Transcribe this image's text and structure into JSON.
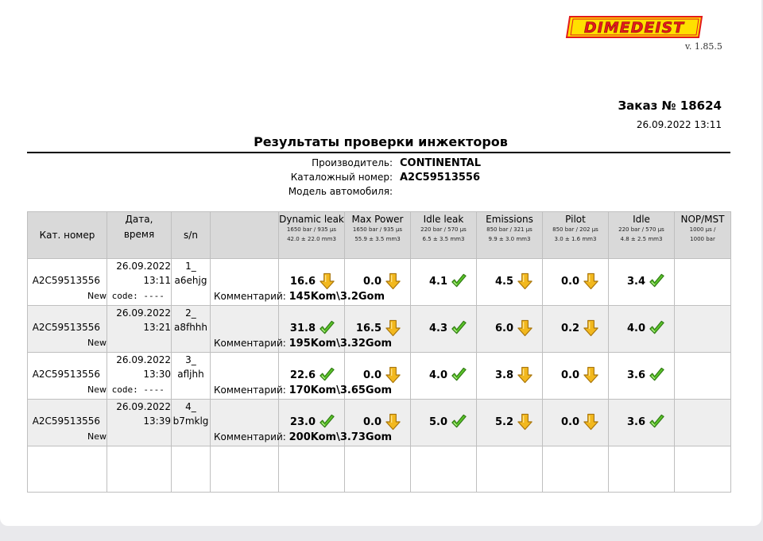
{
  "logo": {
    "text": "DIMEDEIST"
  },
  "version": "v. 1.85.5",
  "order": {
    "title": "Заказ № 18624",
    "date": "26.09.2022  13:11"
  },
  "doc_title": "Результаты проверки инжекторов",
  "info": [
    {
      "label": "Производитель:",
      "value": "CONTINENTAL"
    },
    {
      "label": "Каталожный номер:",
      "value": "A2C59513556"
    },
    {
      "label": "Модель автомобиля:",
      "value": ""
    }
  ],
  "table": {
    "headers": {
      "cat": "Кат. номер",
      "date1": "Дата,",
      "date2": "время",
      "sn": "s/n",
      "tests": [
        {
          "name": "Dynamic leak",
          "spec1": "1650 bar / 935 µs",
          "spec2": "42.0 ± 22.0 mm3"
        },
        {
          "name": "Max Power",
          "spec1": "1650 bar / 935 µs",
          "spec2": "55.9 ± 3.5 mm3"
        },
        {
          "name": "Idle leak",
          "spec1": "220 bar / 570 µs",
          "spec2": "6.5 ± 3.5 mm3"
        },
        {
          "name": "Emissions",
          "spec1": "850 bar / 321 µs",
          "spec2": "9.9 ± 3.0 mm3"
        },
        {
          "name": "Pilot",
          "spec1": "850 bar / 202 µs",
          "spec2": "3.0 ± 1.6 mm3"
        },
        {
          "name": "Idle",
          "spec1": "220 bar / 570 µs",
          "spec2": "4.8 ± 2.5 mm3"
        },
        {
          "name": "NOP/MST",
          "spec1": "1000 µs /",
          "spec2": "1000 bar"
        }
      ]
    },
    "comment_label": "Комментарий:",
    "newcode_label": "New",
    "newcode_value": "code: ----",
    "rows": [
      {
        "cat": "A2C59513556",
        "date": "26.09.2022",
        "time": "13:11",
        "sn1": "1_",
        "sn2": "a6ehjg",
        "comment": "145Kom\\3.2Gom",
        "values": [
          {
            "v": "16.6",
            "ok": false
          },
          {
            "v": "0.0",
            "ok": false
          },
          {
            "v": "4.1",
            "ok": true
          },
          {
            "v": "4.5",
            "ok": false
          },
          {
            "v": "0.0",
            "ok": false
          },
          {
            "v": "3.4",
            "ok": true
          }
        ]
      },
      {
        "cat": "A2C59513556",
        "date": "26.09.2022",
        "time": "13:21",
        "sn1": "2_",
        "sn2": "a8fhhh",
        "comment": "195Kom\\3.32Gom",
        "values": [
          {
            "v": "31.8",
            "ok": true
          },
          {
            "v": "16.5",
            "ok": false
          },
          {
            "v": "4.3",
            "ok": true
          },
          {
            "v": "6.0",
            "ok": false
          },
          {
            "v": "0.2",
            "ok": false
          },
          {
            "v": "4.0",
            "ok": true
          }
        ]
      },
      {
        "cat": "A2C59513556",
        "date": "26.09.2022",
        "time": "13:30",
        "sn1": "3_",
        "sn2": "afljhh",
        "comment": "170Kom\\3.65Gom",
        "values": [
          {
            "v": "22.6",
            "ok": true
          },
          {
            "v": "0.0",
            "ok": false
          },
          {
            "v": "4.0",
            "ok": true
          },
          {
            "v": "3.8",
            "ok": false
          },
          {
            "v": "0.0",
            "ok": false
          },
          {
            "v": "3.6",
            "ok": true
          }
        ]
      },
      {
        "cat": "A2C59513556",
        "date": "26.09.2022",
        "time": "13:39",
        "sn1": "4_",
        "sn2": "b7mklg",
        "comment": "200Kom\\3.73Gom",
        "values": [
          {
            "v": "23.0",
            "ok": true
          },
          {
            "v": "0.0",
            "ok": false
          },
          {
            "v": "5.0",
            "ok": true
          },
          {
            "v": "5.2",
            "ok": false
          },
          {
            "v": "0.0",
            "ok": false
          },
          {
            "v": "3.6",
            "ok": true
          }
        ]
      }
    ]
  },
  "icons": {
    "pass": "green-check-icon",
    "fail": "yellow-down-arrow-icon"
  },
  "colors": {
    "pass": "#5cc42b",
    "fail": "#f2b81e",
    "logo_yellow": "#ffe000",
    "logo_red": "#e21b1b",
    "header_bg": "#d9d9d9"
  }
}
